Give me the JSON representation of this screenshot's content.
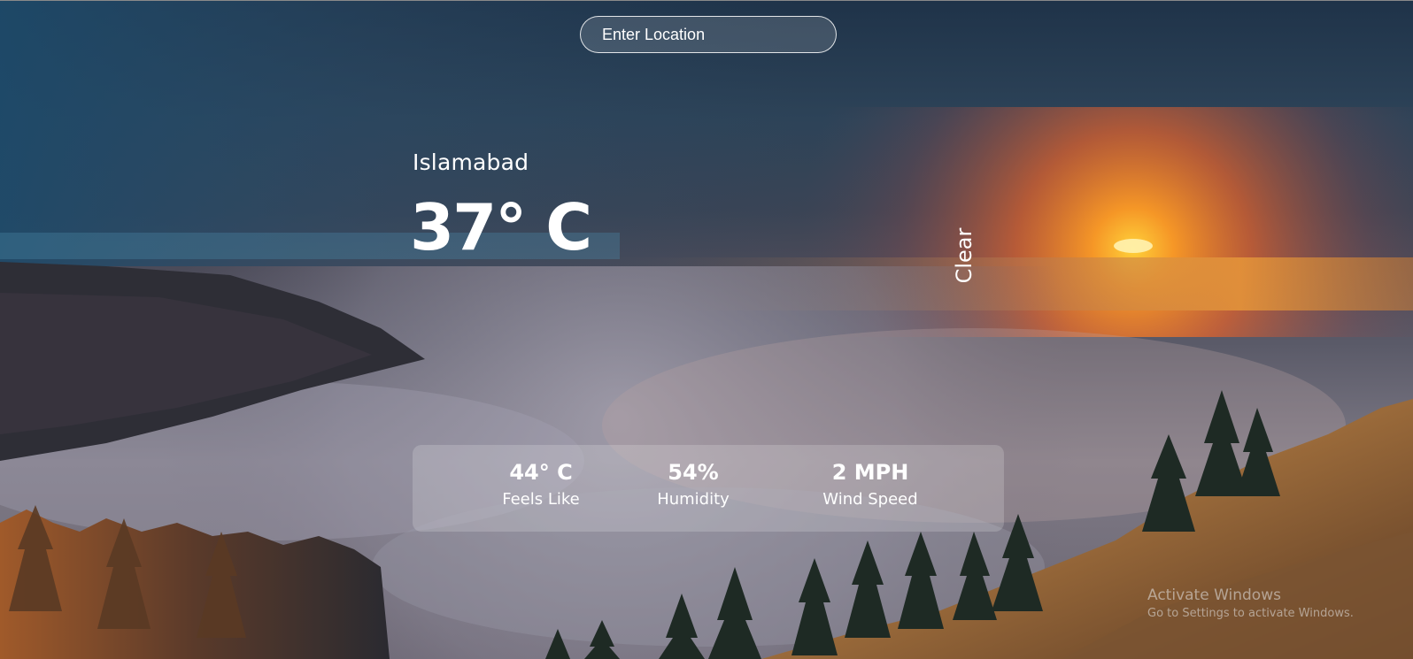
{
  "search": {
    "placeholder": "Enter Location"
  },
  "weather": {
    "city": "Islamabad",
    "temperature": "37° C",
    "condition": "Clear"
  },
  "stats": [
    {
      "value": "44° C",
      "label": "Feels Like"
    },
    {
      "value": "54%",
      "label": "Humidity"
    },
    {
      "value": "2 MPH",
      "label": "Wind Speed"
    }
  ],
  "watermark": {
    "title": "Activate Windows",
    "subtitle": "Go to Settings to activate Windows."
  },
  "colors": {
    "text": "#ffffff",
    "sky_top": "#263a52",
    "sunset": "#e8632a",
    "fog": "#8d8e9c"
  }
}
